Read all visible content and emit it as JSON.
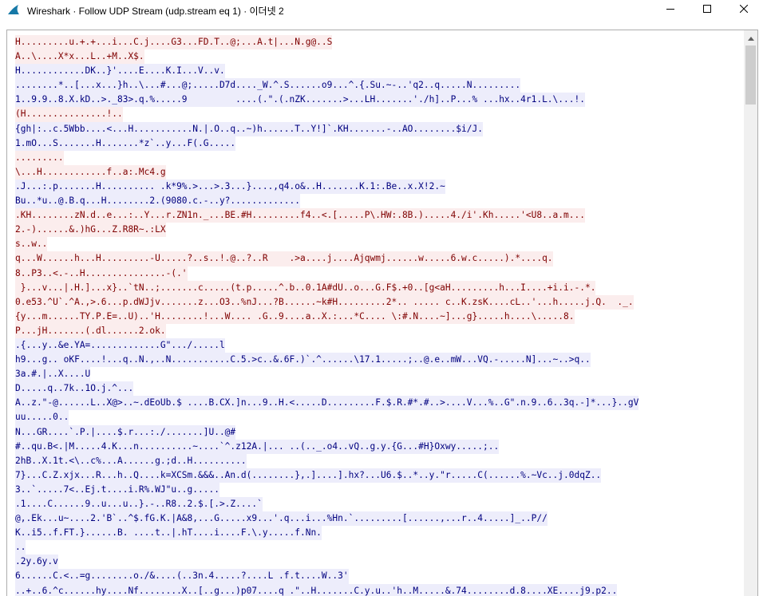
{
  "window": {
    "title": "Wireshark · Follow UDP Stream (udp.stream eq 1) · 이더넷 2",
    "app_icon": "wireshark-fin-icon",
    "minimize_icon": "minimize-icon",
    "maximize_icon": "maximize-icon",
    "close_icon": "close-icon"
  },
  "colors": {
    "client_bg": "#fbeded",
    "client_fg": "#7f0000",
    "server_bg": "#ededfb",
    "server_fg": "#00007f"
  },
  "stream": {
    "lines": [
      {
        "dir": "c",
        "text": "H.........u.+.+...i...C.j....G3...FD.T..@;...A.t|...N.g@..S"
      },
      {
        "dir": "c",
        "text": "A..\\....X*x...L..+M..X$."
      },
      {
        "dir": "s",
        "text": "H............DK..}'....E....K.I...V..v."
      },
      {
        "dir": "s",
        "text": "........*..[...x...}h..\\...#...@;.....D7d...._W.^.S......o9...^.{.Su.~-..'q2..q.....N........."
      },
      {
        "dir": "s",
        "text": "1..9.9..8.X.kD..>._83>.q.%.....9         ....(.\".(.nZK.......>...LH.......'./h]..P...% ...hx..4r1.L.\\...!."
      },
      {
        "dir": "c",
        "text": "(H...............!.."
      },
      {
        "dir": "s",
        "text": "{gh|:..c.5Wbb....<...H...........N.|.O..q..~)h......T..Y!]`.KH.......-..AO........$i/J."
      },
      {
        "dir": "s",
        "text": "1.mO...S.......H.......*z`..y...F(.G....."
      },
      {
        "dir": "c",
        "text": "........."
      },
      {
        "dir": "c",
        "text": "\\...H............f..a:.Mc4.g"
      },
      {
        "dir": "s",
        "text": ".J...:.p.......H.......... .k*9%.>...>.3...}....,q4.o&..H.......K.1:.Be..x.X!2.~"
      },
      {
        "dir": "s",
        "text": "Bu..*u..@.B.q...H........2.(9080.c.-..y?............."
      },
      {
        "dir": "c",
        "text": ".KH........zN.d..e...:..Y...r.ZN1n._...BE.#H.........f4..<.[.....P\\.HW:.8B.).....4./i'.Kh.....'<U8..a.m..."
      },
      {
        "dir": "c",
        "text": "2.-)......&.)hG...Z.R8R~.:LX"
      },
      {
        "dir": "c",
        "text": "s..w.."
      },
      {
        "dir": "c",
        "text": "q...W......h...H.........-U.....?..s..!.@..?..R    .>a....j....Ajqwmj......w.....6.w.c.....).*....q."
      },
      {
        "dir": "c",
        "text": "8..P3..<.-..H...............-(.'"
      },
      {
        "dir": "c",
        "text": " }...v...|.H.]...x}..`tN..;.......c.....(t.p.....^.b..0.1A#dU..o...G.F$.+0..[g<aH.........h...I....+i.i.-.*."
      },
      {
        "dir": "c",
        "text": "0.e53.^U`.^A.,>.6...p.dWJjv.......z...O3..%nJ...?B......~k#H.........2*.. ..... c..K.zsK....cL..'...h.....j.Q.  ._."
      },
      {
        "dir": "c",
        "text": "{y...m......TY.P.E=..U)..'H........!...W.... .G..9....a..X.:...*C.... \\:#.N....~]...g}.....h....\\.....8."
      },
      {
        "dir": "c",
        "text": "P...jH.......(.dl......2.ok."
      },
      {
        "dir": "s",
        "text": ".{...y..&e.YA=.............G\".../.....l"
      },
      {
        "dir": "s",
        "text": "h9...g.. oKF....!...q..N.,..N...........C.5.>c..&.6F.)`.^......\\17.1.....;..@.e..mW...VQ.-.....N]...~..>q.."
      },
      {
        "dir": "s",
        "text": "3a.#.|..X....U"
      },
      {
        "dir": "s",
        "text": "D.....q..7k..1O.j.^..."
      },
      {
        "dir": "s",
        "text": "A..z.\"-@......L..X@>..~.dEoUb.$ ....B.CX.]n...9..H.<.....D.........F.$.R.#*.#..>....V...%..G\".n.9..6..3q.-]*...}..gV"
      },
      {
        "dir": "s",
        "text": "uu.....0.."
      },
      {
        "dir": "s",
        "text": "N...GR....`.P.|....$.r...:./.......]U..@#"
      },
      {
        "dir": "s",
        "text": "#..qu.B<.|M.....4.K...n..........~....`^.z12A.|... ..(.._.o4..vQ..g.y.{G...#H}Oxwy.....;.."
      },
      {
        "dir": "s",
        "text": "2hB..X.1t.<\\..c%...A......g.;d..H.........."
      },
      {
        "dir": "s",
        "text": "7}...C.Z.xjx...R...h..Q....k=XCSm.&&&..An.d(........},.]....].hx?...U6.$..*..y.\"r.....C(......%.~Vc..j.0dqZ.."
      },
      {
        "dir": "s",
        "text": "3..`.....7<..Ej.t....i.R%.WJ\"u..g....."
      },
      {
        "dir": "s",
        "text": ".1....C......9..u...u..}.-..R8..2.$.[.>.Z....`"
      },
      {
        "dir": "s",
        "text": "@,.Ek...u~....2.'B`..^$.fG.K.|A&8,...G.....x9...'.q...i...%Hn.`.........[......,...r..4.....]_..P//"
      },
      {
        "dir": "s",
        "text": "K..i5..f.FT.}......B. ....t..|.hT....i....F.\\.y.....f.Nn."
      },
      {
        "dir": "s",
        "text": ".."
      },
      {
        "dir": "s",
        "text": ".2y.6y.v"
      },
      {
        "dir": "s",
        "text": "6......C.<..=g........o./&....(..3n.4.....?....L .f.t....W..3'"
      },
      {
        "dir": "s",
        "text": "..+..6.^c......hy....Nf........X..[..g...)p07....q .\"..H.......C.y.u..'h..M.....&.74........d.8....XE....j9.p2.."
      }
    ]
  },
  "scrollbar": {
    "up_icon": "scroll-up-arrow-icon"
  }
}
